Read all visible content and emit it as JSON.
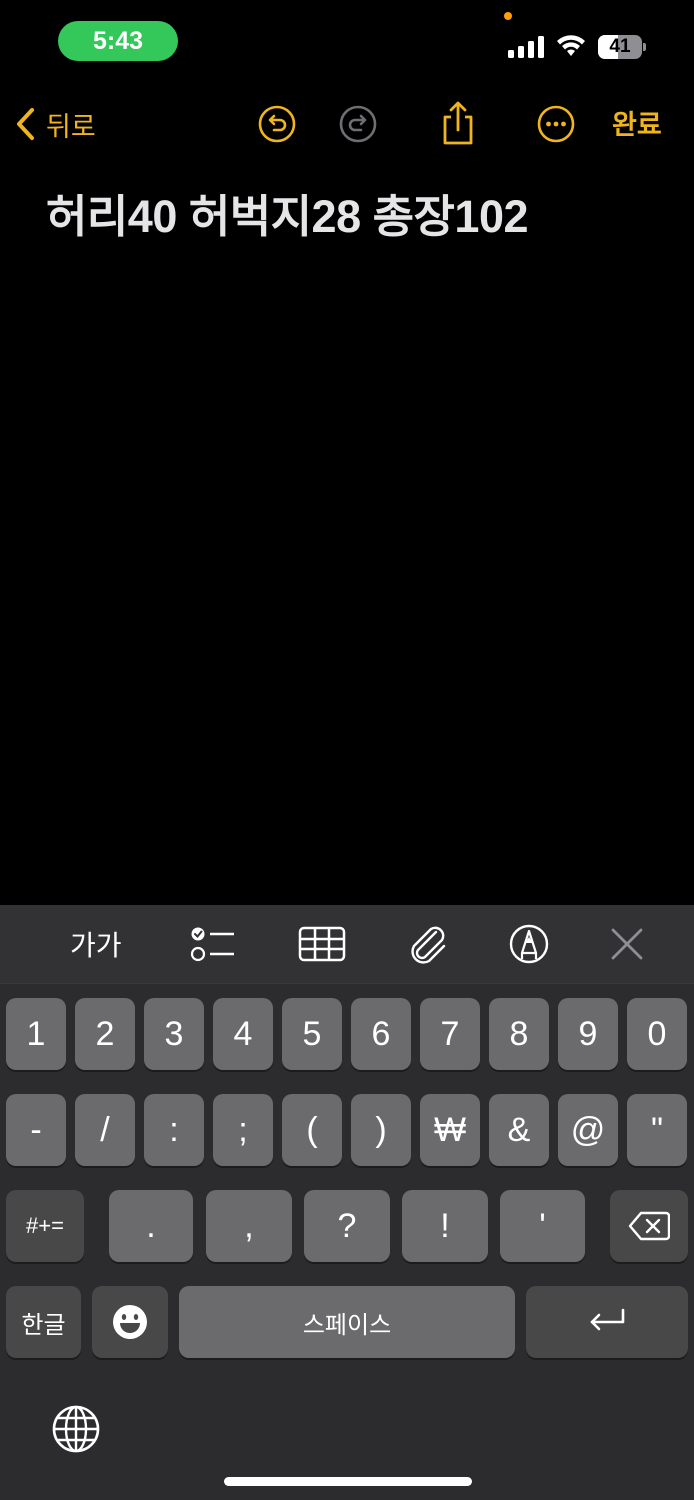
{
  "status_bar": {
    "time": "5:43",
    "battery": "41"
  },
  "nav": {
    "back_label": "뒤로",
    "done_label": "완료"
  },
  "note": {
    "text": "허리40 허벅지28 총장102"
  },
  "toolbar": {
    "format_label": "가가"
  },
  "keyboard": {
    "row1": [
      "1",
      "2",
      "3",
      "4",
      "5",
      "6",
      "7",
      "8",
      "9",
      "0"
    ],
    "row2": [
      "-",
      "/",
      ":",
      ";",
      "(",
      ")",
      "₩",
      "&",
      "@",
      "\""
    ],
    "row3_left": "#+=",
    "row3": [
      ".",
      ",",
      "?",
      "!",
      "'"
    ],
    "row4_lang": "한글",
    "space": "스페이스"
  },
  "colors": {
    "accent": "#f0b51e",
    "status_green": "#34c759",
    "keyboard_bg": "#2c2c2e",
    "key": "#6b6b6d"
  }
}
